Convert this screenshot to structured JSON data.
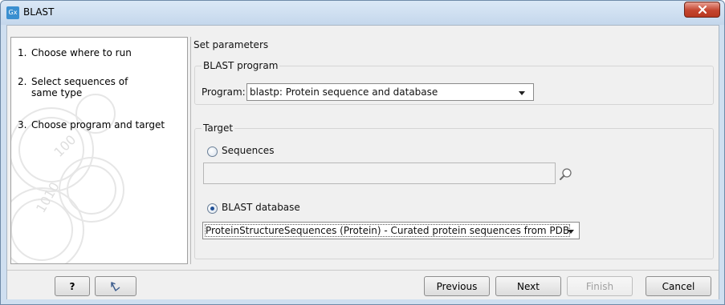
{
  "window": {
    "app_icon_text": "Gx",
    "title": "BLAST",
    "close_icon": "close-x-icon"
  },
  "steps": [
    {
      "number": "1.",
      "label": "Choose where to run"
    },
    {
      "number": "2.",
      "label": "Select sequences of same type"
    },
    {
      "number": "3.",
      "label": "Choose program and target"
    }
  ],
  "main": {
    "section_title": "Set parameters",
    "blast_program": {
      "group_label": "BLAST program",
      "program_label": "Program:",
      "program_value": "blastp: Protein sequence and database"
    },
    "target": {
      "group_label": "Target",
      "sequences_label": "Sequences",
      "sequences_selected": false,
      "sequences_value": "",
      "browse_icon": "magnifier-browse-icon",
      "blast_database_label": "BLAST database",
      "blast_database_selected": true,
      "database_value": "ProteinStructureSequences (Protein) - Curated protein sequences from PDB"
    }
  },
  "buttons": {
    "help": "?",
    "reset_icon": "reset-arrow-icon",
    "previous": "Previous",
    "next": "Next",
    "finish": "Finish",
    "cancel": "Cancel"
  }
}
